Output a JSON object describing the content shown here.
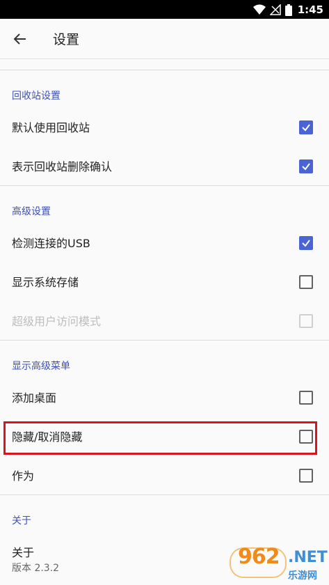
{
  "status_bar": {
    "time": "1:45"
  },
  "app_bar": {
    "title": "设置"
  },
  "sections": {
    "recycle": {
      "header": "回收站设置",
      "items": [
        {
          "label": "默认使用回收站",
          "checked": true
        },
        {
          "label": "表示回收站删除确认",
          "checked": true
        }
      ]
    },
    "advanced": {
      "header": "高级设置",
      "items": [
        {
          "label": "检测连接的USB",
          "checked": true
        },
        {
          "label": "显示系统存储",
          "checked": false
        },
        {
          "label": "超级用户访问模式",
          "checked": false,
          "disabled": true
        }
      ]
    },
    "menu": {
      "header": "显示高级菜单",
      "items": [
        {
          "label": "添加桌面",
          "checked": false
        },
        {
          "label": "隐藏/取消隐藏",
          "checked": false
        },
        {
          "label": "作为",
          "checked": false
        }
      ]
    },
    "about": {
      "header": "关于",
      "title": "关于",
      "version": "版本 2.3.2"
    }
  },
  "watermark": {
    "number": "962",
    "domain": ".NET",
    "site": "乐游网"
  },
  "colors": {
    "accent": "#3f51b5",
    "checkbox": "#4a64d6",
    "highlight": "#d6161c"
  }
}
